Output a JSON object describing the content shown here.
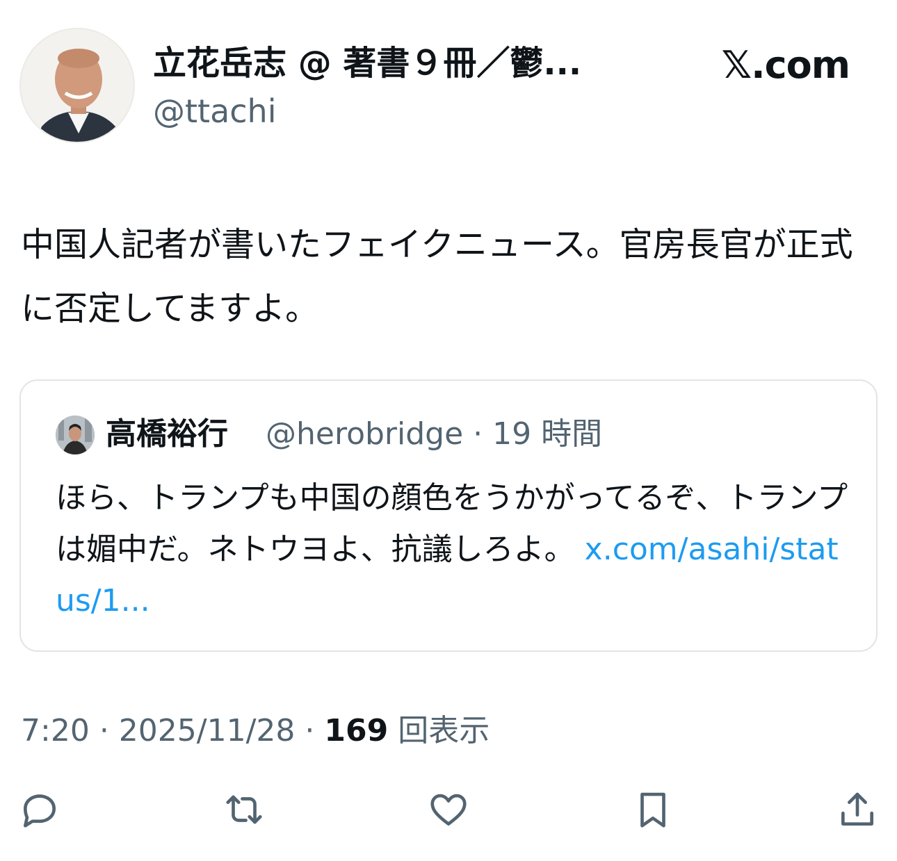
{
  "header": {
    "display_name": "立花岳志 @ 著書９冊／鬱...",
    "handle": "@ttachi",
    "brand": "𝕏.com"
  },
  "tweet": {
    "text": "中国人記者が書いたフェイクニュース。官房長官が正式に否定してますよ。"
  },
  "quote": {
    "display_name": "高橋裕行",
    "meta": "@herobridge · 19 時間",
    "text": "ほら、トランプも中国の顔色をうかがってるぞ、トランプは媚中だ。ネトウヨよ、抗議しろよ。 ",
    "link": "x.com/asahi/status/1..."
  },
  "meta": {
    "time": "7:20",
    "date": "2025/11/28",
    "views_count": "169",
    "views_label": "回表示"
  },
  "actions": {
    "icons": [
      "reply-icon",
      "retweet-icon",
      "like-icon",
      "bookmark-icon",
      "share-icon"
    ]
  },
  "colors": {
    "text": "#0f1419",
    "secondary": "#536471",
    "link": "#1d9bf0",
    "border": "#e1e4e7"
  }
}
